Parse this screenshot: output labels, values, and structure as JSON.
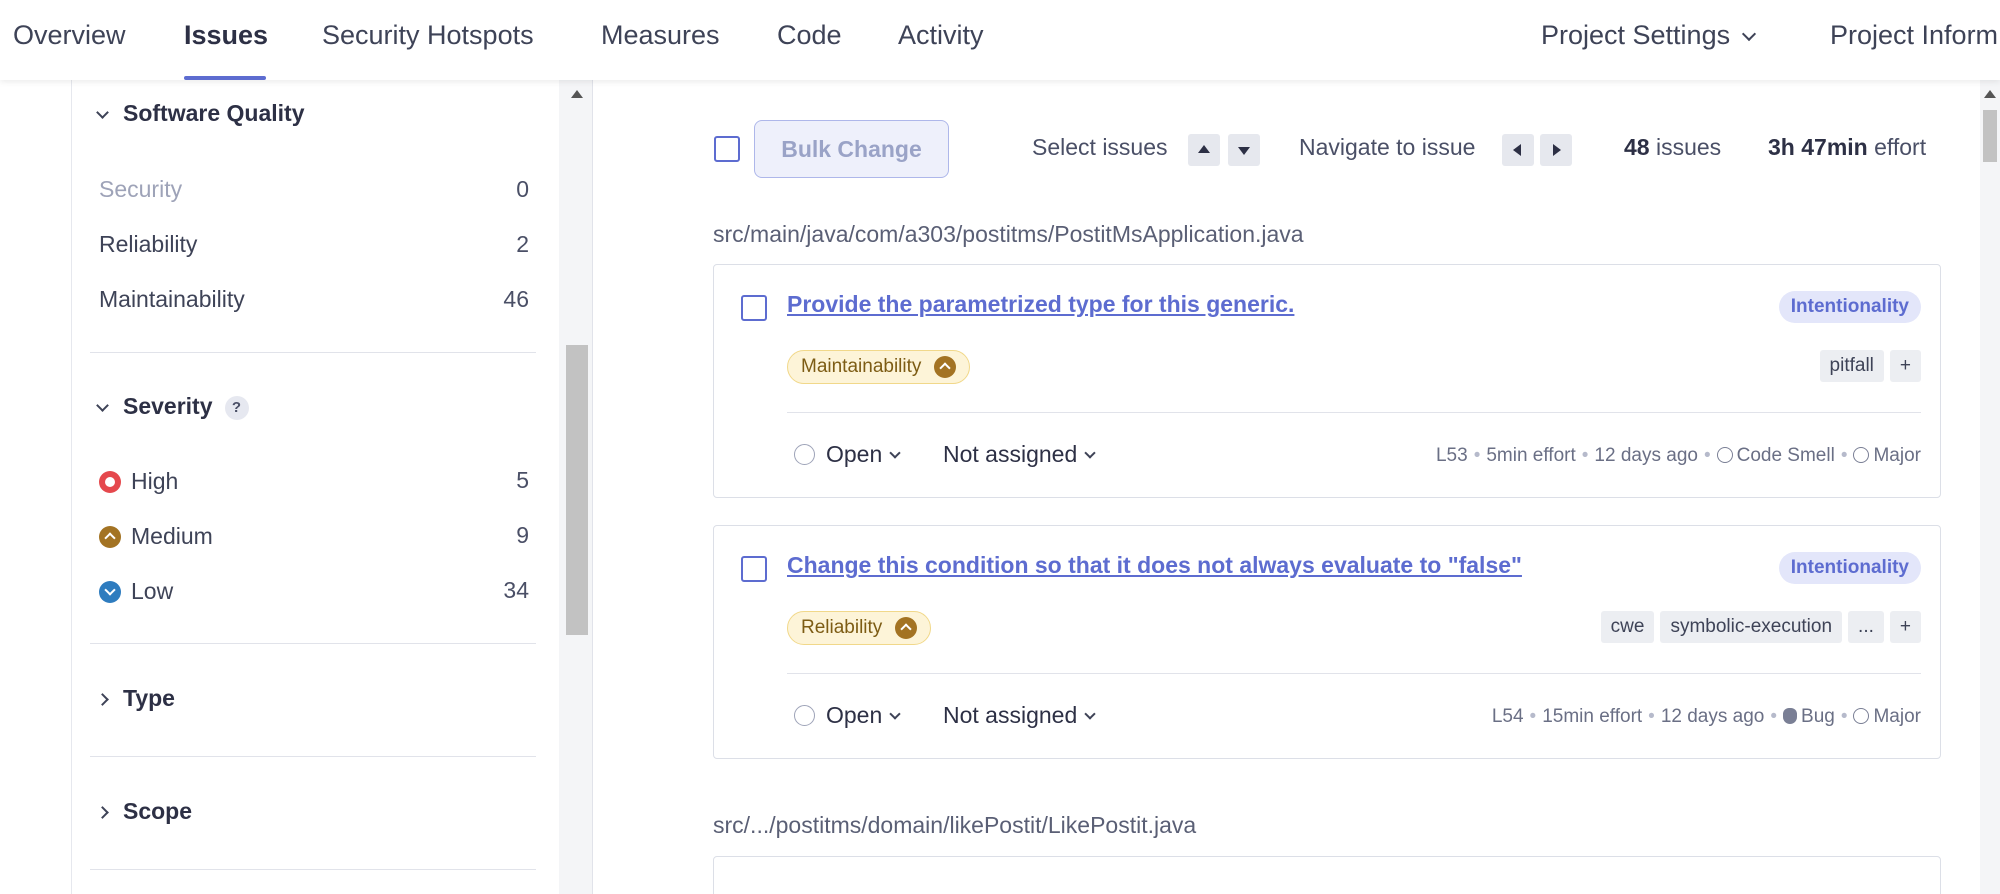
{
  "topnav": {
    "tabs": [
      {
        "label": "Overview"
      },
      {
        "label": "Issues",
        "active": true
      },
      {
        "label": "Security Hotspots"
      },
      {
        "label": "Measures"
      },
      {
        "label": "Code"
      },
      {
        "label": "Activity"
      }
    ],
    "project_settings": "Project Settings",
    "project_info": "Project Inform"
  },
  "sidebar": {
    "software_quality": {
      "title": "Software Quality",
      "items": [
        {
          "label": "Security",
          "count": "0"
        },
        {
          "label": "Reliability",
          "count": "2"
        },
        {
          "label": "Maintainability",
          "count": "46"
        }
      ]
    },
    "severity": {
      "title": "Severity",
      "help": "?",
      "items": [
        {
          "label": "High",
          "count": "5",
          "icon": "severity-high-icon"
        },
        {
          "label": "Medium",
          "count": "9",
          "icon": "severity-medium-icon"
        },
        {
          "label": "Low",
          "count": "34",
          "icon": "severity-low-icon"
        }
      ]
    },
    "type": {
      "title": "Type"
    },
    "scope": {
      "title": "Scope"
    }
  },
  "toolbar": {
    "bulk_change": "Bulk Change",
    "select_issues": "Select issues",
    "navigate_to_issue": "Navigate to issue",
    "issues_count": "48",
    "issues_label": "issues",
    "effort_value": "3h 47min",
    "effort_label": "effort"
  },
  "files": [
    {
      "path": "src/main/java/com/a303/postitms/PostitMsApplication.java",
      "issues": [
        {
          "title": "Provide the parametrized type for this generic.",
          "attribute": "Intentionality",
          "quality": "Maintainability",
          "tags": [
            "pitfall",
            "+"
          ],
          "status": "Open",
          "assignee": "Not assigned",
          "line": "L53",
          "effort": "5min effort",
          "age": "12 days ago",
          "type": "Code Smell",
          "severity": "Major"
        },
        {
          "title": "Change this condition so that it does not always evaluate to \"false\"",
          "attribute": "Intentionality",
          "quality": "Reliability",
          "tags": [
            "cwe",
            "symbolic-execution",
            "...",
            "+"
          ],
          "status": "Open",
          "assignee": "Not assigned",
          "line": "L54",
          "effort": "15min effort",
          "age": "12 days ago",
          "type": "Bug",
          "severity": "Major"
        }
      ]
    },
    {
      "path": "src/.../postitms/domain/likePostit/LikePostit.java"
    }
  ],
  "colors": {
    "accent": "#5d6cd0",
    "severity_high": "#e5484d",
    "severity_medium": "#a37323",
    "severity_low": "#2e7cbf"
  }
}
